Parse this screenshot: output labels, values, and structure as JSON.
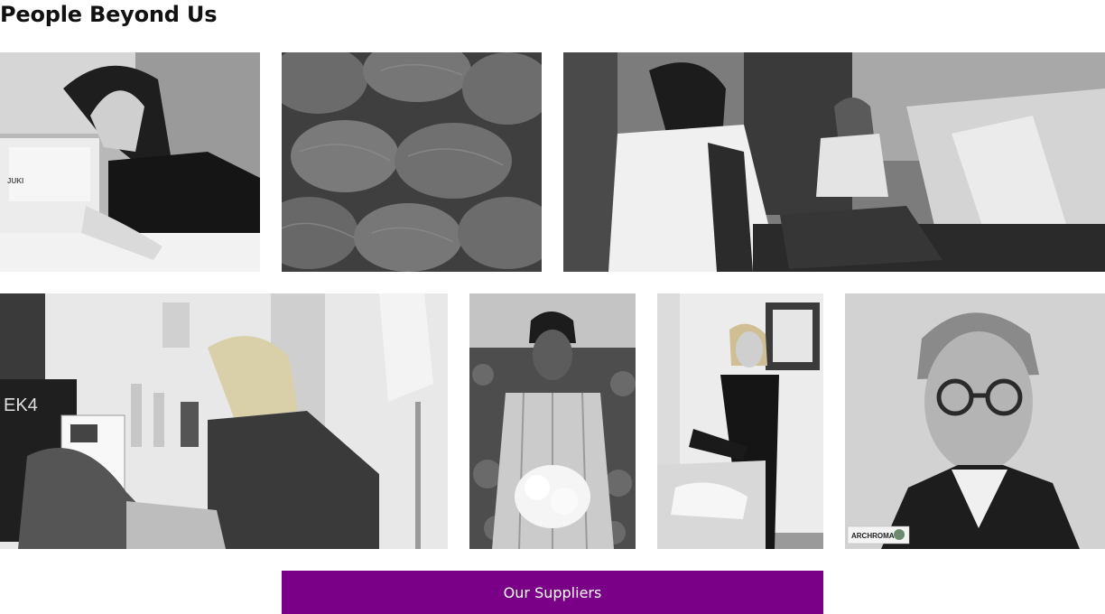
{
  "page": {
    "title": "People Beyond Us"
  },
  "gallery": {
    "photos": [
      {
        "name": "seamstress-sewing-machine-photo",
        "machine_brand": "JUKI"
      },
      {
        "name": "wool-yarn-skeins-photo"
      },
      {
        "name": "tailors-workshop-photo"
      },
      {
        "name": "designer-studio-photo",
        "board_text": "EK4"
      },
      {
        "name": "cotton-farmer-photo"
      },
      {
        "name": "tailor-cutting-fabric-photo"
      },
      {
        "name": "executive-portrait-photo",
        "logo_text": "ARCHROMA"
      }
    ]
  },
  "cta": {
    "label": "Our Suppliers",
    "color": "#7a0087"
  }
}
